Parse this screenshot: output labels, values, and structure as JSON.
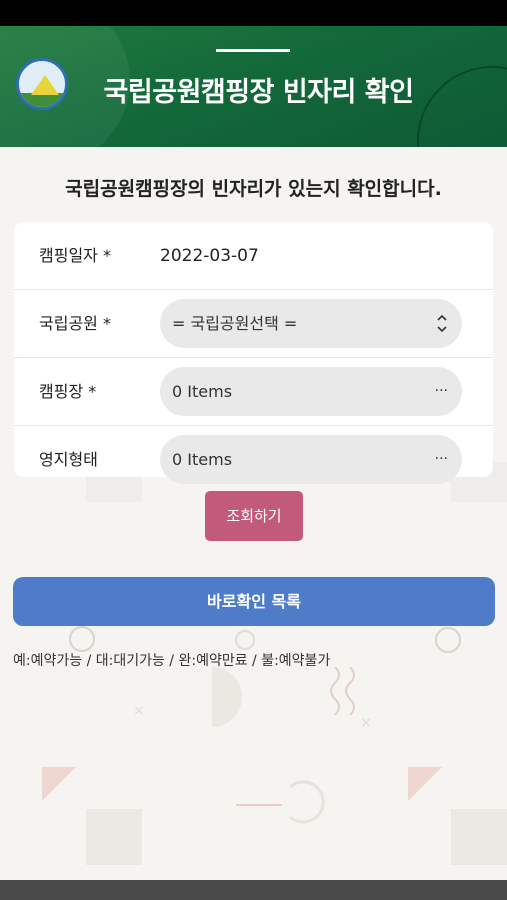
{
  "header": {
    "title": "국립공원캠핑장 빈자리 확인",
    "logo_icon": "camping-tent-logo-icon"
  },
  "page": {
    "subtitle": "국립공원캠핑장의 빈자리가 있는지 확인합니다."
  },
  "form": {
    "date": {
      "label": "캠핑일자 *",
      "value": "2022-03-07"
    },
    "park": {
      "label": "국립공원 *",
      "value": "= 국립공원선택 =",
      "icon": "up-down-chevron-icon"
    },
    "campsite": {
      "label": "캠핑장 *",
      "value": "0 Items",
      "icon": "ellipsis-icon",
      "icon_glyph": "···"
    },
    "site_type": {
      "label": "영지형태",
      "value": "0 Items",
      "icon": "ellipsis-icon",
      "icon_glyph": "···"
    }
  },
  "buttons": {
    "query_label": "조회하기",
    "quick_list_label": "바로확인 목록"
  },
  "legend": "예:예약가능 / 대:대기가능 / 완:예약만료 / 불:예약불가",
  "colors": {
    "header_green": "#13693a",
    "query_button": "#c25a7c",
    "quick_button": "#4f7cc8",
    "background": "#f6f4f1"
  }
}
